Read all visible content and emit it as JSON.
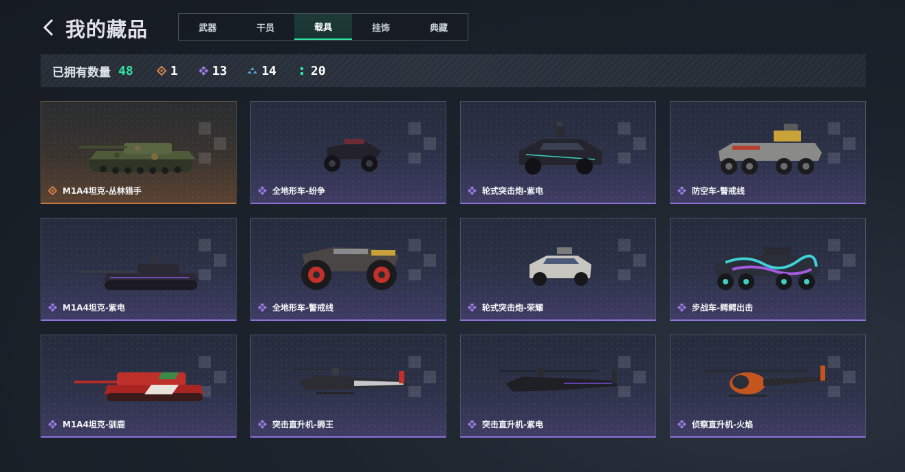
{
  "header": {
    "title": "我的藏品"
  },
  "tabs": [
    {
      "label": "武器",
      "active": false
    },
    {
      "label": "干员",
      "active": false
    },
    {
      "label": "载具",
      "active": true
    },
    {
      "label": "挂饰",
      "active": false
    },
    {
      "label": "典藏",
      "active": false
    }
  ],
  "stats": {
    "label": "已拥有数量",
    "total": "48",
    "rarities": [
      {
        "icon": "orange-diamond-icon",
        "color": "#d9844a",
        "count": "1"
      },
      {
        "icon": "purple-diamond-icon",
        "color": "#9b7be0",
        "count": "13"
      },
      {
        "icon": "blue-triangle-icon",
        "color": "#5ba7e0",
        "count": "14"
      },
      {
        "icon": "green-dots-icon",
        "color": "#2ee3a0",
        "count": "20"
      }
    ]
  },
  "colors": {
    "accent_green": "#2ee3a0",
    "rarity_gold": "#d9844a",
    "rarity_purple": "#9b7be0"
  },
  "items": [
    {
      "name": "M1A4坦克-丛林猎手",
      "rarity": "gold",
      "vehicle": "tank-camo-icon"
    },
    {
      "name": "全地形车-纷争",
      "rarity": "purple",
      "vehicle": "atv-dark-icon"
    },
    {
      "name": "轮式突击炮-紫电",
      "rarity": "purple",
      "vehicle": "armored-car-dark-icon"
    },
    {
      "name": "防空车-警戒线",
      "rarity": "purple",
      "vehicle": "aa-vehicle-hazard-icon"
    },
    {
      "name": "M1A4坦克-紫电",
      "rarity": "purple",
      "vehicle": "tank-dark-icon"
    },
    {
      "name": "全地形车-警戒线",
      "rarity": "purple",
      "vehicle": "atv-hazard-icon"
    },
    {
      "name": "轮式突击炮-荣耀",
      "rarity": "purple",
      "vehicle": "armored-car-white-icon"
    },
    {
      "name": "步战车-鳄鳄出击",
      "rarity": "purple",
      "vehicle": "ifv-graffiti-icon"
    },
    {
      "name": "M1A4坦克-驯鹿",
      "rarity": "purple",
      "vehicle": "tank-red-icon"
    },
    {
      "name": "突击直升机-狮王",
      "rarity": "purple",
      "vehicle": "helicopter-lion-icon"
    },
    {
      "name": "突击直升机-紫电",
      "rarity": "purple",
      "vehicle": "helicopter-dark-icon"
    },
    {
      "name": "侦察直升机-火焰",
      "rarity": "purple",
      "vehicle": "scout-helicopter-orange-icon"
    }
  ]
}
